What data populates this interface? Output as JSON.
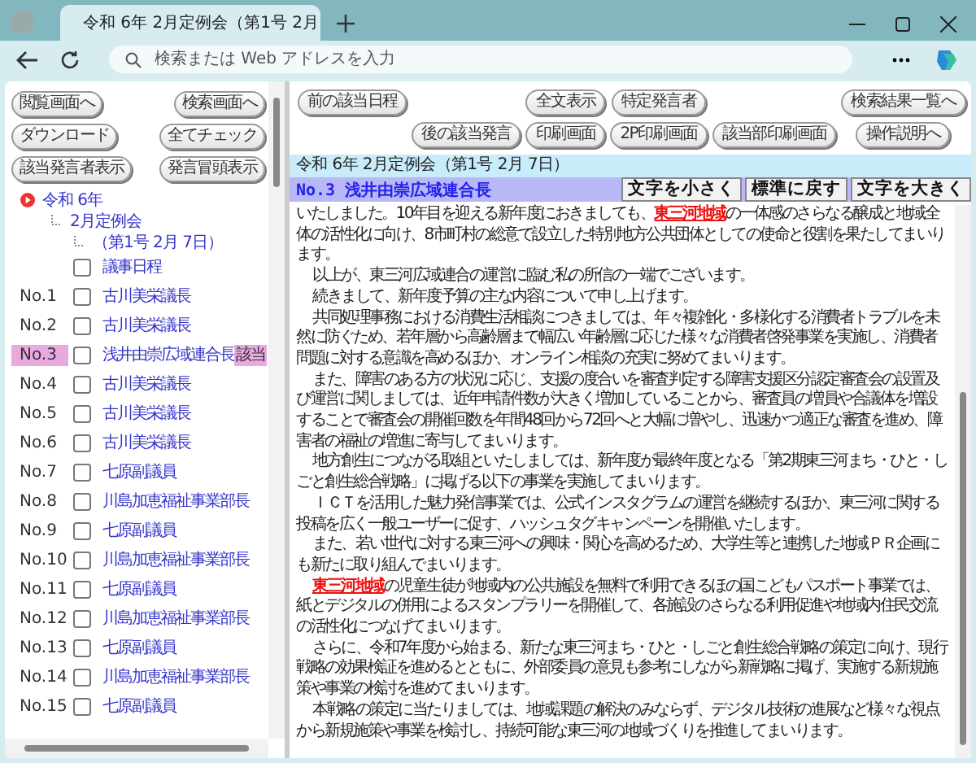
{
  "browser": {
    "tab_title": "令和 6年 2月定例会（第1号 2月",
    "address_placeholder": "検索または Web アドレスを入力"
  },
  "left_buttons": [
    "閲覧画面へ",
    "検索画面へ",
    "ダウンロード",
    "全てチェック",
    "該当発言者表示",
    "発言冒頭表示"
  ],
  "tree": {
    "label": "令和 6年",
    "children": [
      {
        "label": "2月定例会",
        "children": [
          {
            "label": "（第1号 2月 7日）"
          }
        ]
      }
    ]
  },
  "agenda_item": {
    "label": "議事日程",
    "checked": false
  },
  "speakers": [
    {
      "no": "No.1",
      "name": "古川美栄議長",
      "checked": false,
      "highlighted": false
    },
    {
      "no": "No.2",
      "name": "古川美栄議長",
      "checked": false,
      "highlighted": false
    },
    {
      "no": "No.3",
      "name": "浅井由崇広域連合長",
      "checked": false,
      "highlighted": true,
      "tag": "該当"
    },
    {
      "no": "No.4",
      "name": "古川美栄議長",
      "checked": false,
      "highlighted": false
    },
    {
      "no": "No.5",
      "name": "古川美栄議長",
      "checked": false,
      "highlighted": false
    },
    {
      "no": "No.6",
      "name": "古川美栄議長",
      "checked": false,
      "highlighted": false
    },
    {
      "no": "No.7",
      "name": "七原副議員",
      "checked": false,
      "highlighted": false
    },
    {
      "no": "No.8",
      "name": "川島加恵福祉事業部長",
      "checked": false,
      "highlighted": false
    },
    {
      "no": "No.9",
      "name": "七原副議員",
      "checked": false,
      "highlighted": false
    },
    {
      "no": "No.10",
      "name": "川島加恵福祉事業部長",
      "checked": false,
      "highlighted": false
    },
    {
      "no": "No.11",
      "name": "七原副議員",
      "checked": false,
      "highlighted": false
    },
    {
      "no": "No.12",
      "name": "川島加恵福祉事業部長",
      "checked": false,
      "highlighted": false
    },
    {
      "no": "No.13",
      "name": "七原副議員",
      "checked": false,
      "highlighted": false
    },
    {
      "no": "No.14",
      "name": "川島加恵福祉事業部長",
      "checked": false,
      "highlighted": false
    },
    {
      "no": "No.15",
      "name": "七原副議員",
      "checked": false,
      "highlighted": false
    }
  ],
  "toolbar": {
    "row_1": [
      "前の該当日程",
      "全文表示",
      "特定発言者",
      "検索結果一覧へ"
    ],
    "row_2": [
      "後の該当発言",
      "印刷画面",
      "2P印刷画面",
      "該当部印刷画面",
      "操作説明へ"
    ]
  },
  "meeting_title": "令和 6年 2月定例会（第1号 2月 7日）",
  "speech_title": "No.3 浅井由崇広域連合長",
  "font_buttons": [
    "文字を小さく",
    "標準に戻す",
    "文字を大きく"
  ],
  "paragraphs": [
    "いたしました。10年目を迎える新年度におきましても、**東三河地域**の一体感のさらなる醸成と地域全体の活性化に向け、8市町村の総意で設立した特別地方公共団体としての使命と役割を果たしてまいります。",
    "以上が、東三河広域連合の運営に臨む私の所信の一端でございます。",
    "続きまして、新年度予算の主な内容について申し上げます。",
    "共同処理事務における消費生活相談につきましては、年々複雑化・多様化する消費者トラブルを未然に防ぐため、若年層から高齢層まで幅広い年齢層に応じた様々な消費者啓発事業を実施し、消費者問題に対する意識を高めるほか、オンライン相談の充実に努めてまいります。",
    "また、障害のある方の状況に応じ、支援の度合いを審査判定する障害支援区分認定審査会の設置及び運営に関しましては、近年申請件数が大きく増加していることから、審査員の増員や合議体を増設することで審査会の開催回数を年間48回から72回へと大幅に増やし、迅速かつ適正な審査を進め、障害者の福祉の増進に寄与してまいります。",
    "地方創生につながる取組といたしましては、新年度が最終年度となる「第2期東三河まち・ひと・しごと創生総合戦略」に掲げる以下の事業を実施してまいります。",
    "ＩＣＴを活用した魅力発信事業では、公式インスタグラムの運営を継続するほか、東三河に関する投稿を広く一般ユーザーに促す、ハッシュタグキャンペーンを開催いたします。",
    "また、若い世代に対する東三河への興味・関心を高めるため、大学生等と連携した地域ＰＲ企画にも新たに取り組んでまいります。",
    "**東三河地域**の児童生徒が地域内の公共施設を無料で利用できるほの国こどもパスポート事業では、紙とデジタルの併用によるスタンプラリーを開催して、各施設のさらなる利用促進や地域内住民交流の活性化につなげてまいります。",
    "さらに、令和7年度から始まる、新たな東三河まち・ひと・しごと創生総合戦略の策定に向け、現行戦略の効果検証を進めるとともに、外部委員の意見も参考にしながら新戦略に掲げ、実施する新規施策や事業の検討を進めてまいります。",
    "本戦略の策定に当たりましては、地域課題の解決のみならず、デジタル技術の進展など様々な視点から新規施策や事業を検討し、持続可能な東三河の地域づくりを推進してまいります。"
  ]
}
